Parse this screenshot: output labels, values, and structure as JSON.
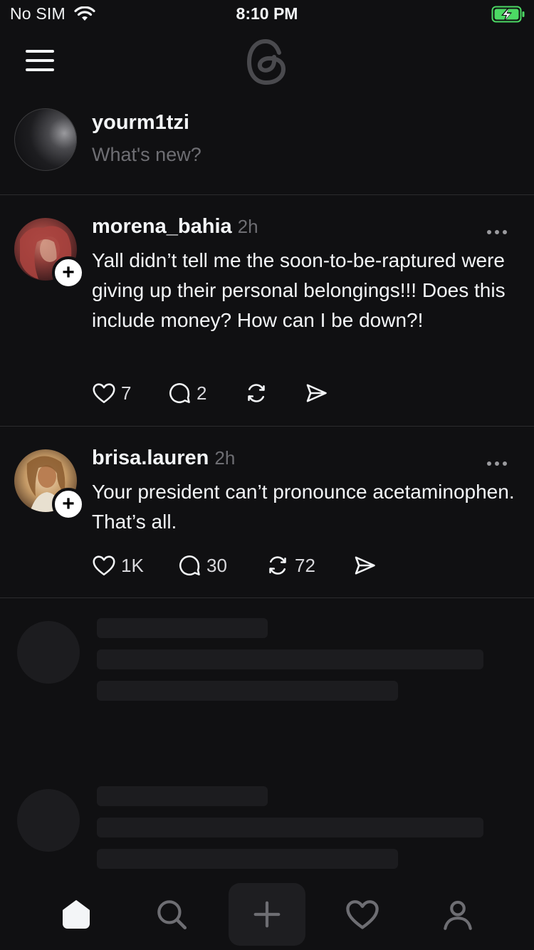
{
  "status_bar": {
    "carrier": "No SIM",
    "time": "8:10 PM",
    "battery_charging": true
  },
  "header": {
    "logo_icon": "threads-logo",
    "menu_icon": "hamburger-menu-icon"
  },
  "composer": {
    "username": "yourm1tzi",
    "placeholder": "What's new?"
  },
  "posts": [
    {
      "author": "morena_bahia",
      "time_ago": "2h",
      "text": "Yall didn’t tell me the soon-to-be-raptured were giving up their personal belongings!!! Does this include money? How can I be down?!",
      "likes": "7",
      "replies": "2",
      "reposts": "",
      "avatar_color": "#8a3a3a"
    },
    {
      "author": "brisa.lauren",
      "time_ago": "2h",
      "text": "Your president can’t pronounce acetaminophen. That’s all.",
      "likes": "1K",
      "replies": "30",
      "reposts": "72",
      "avatar_color": "#c8a070"
    }
  ],
  "tab_bar": {
    "items": [
      "home-icon",
      "search-icon",
      "create-icon",
      "activity-heart-icon",
      "profile-icon"
    ],
    "active": "home-icon"
  },
  "colors": {
    "background": "#101012",
    "text": "#f3f5f7",
    "muted": "#6e6e73",
    "divider": "#2c2c2e",
    "skeleton": "#1c1c1f"
  }
}
